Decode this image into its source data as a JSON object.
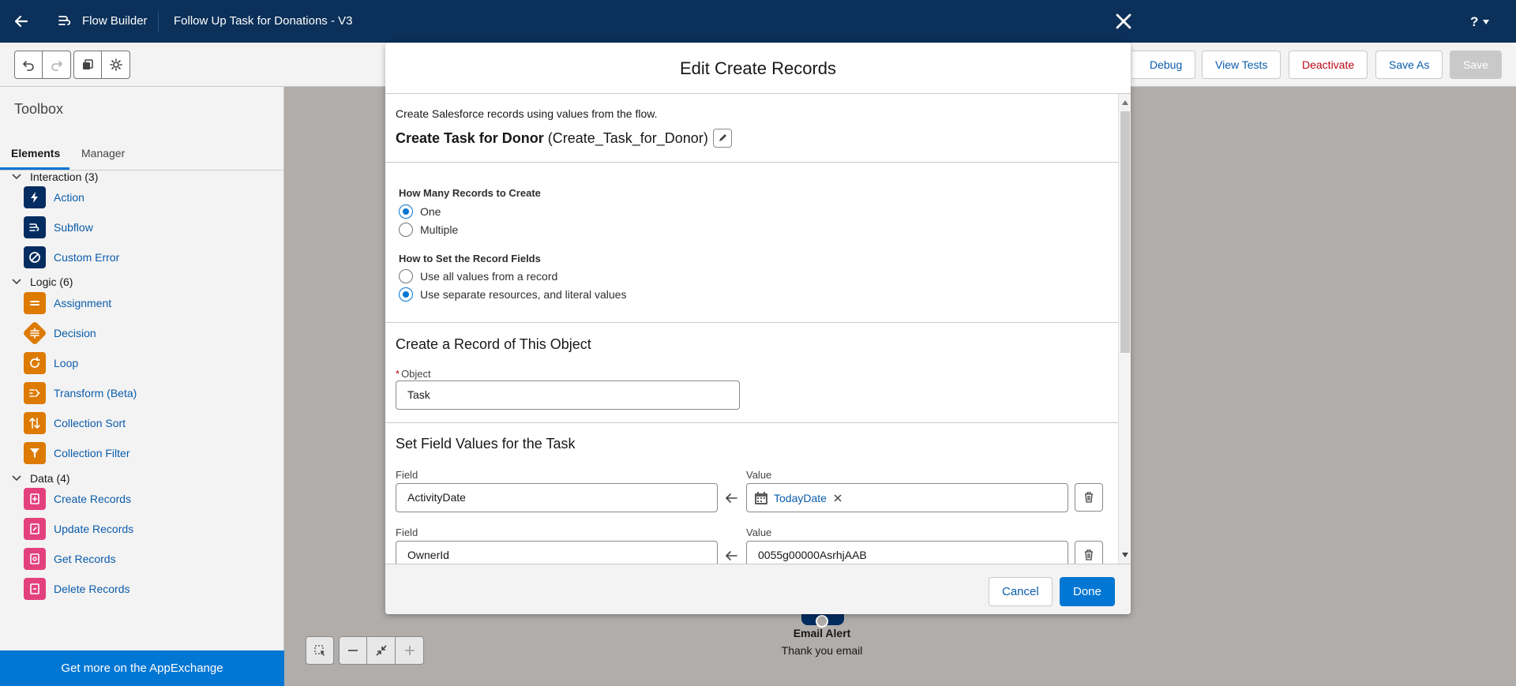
{
  "header": {
    "app_label": "Flow Builder",
    "flow_name": "Follow Up Task for Donations - V3",
    "help_label": "?"
  },
  "toolbar": {
    "debug_label": "Debug",
    "view_tests_label": "View Tests",
    "deactivate_label": "Deactivate",
    "save_as_label": "Save As",
    "save_label": "Save"
  },
  "toolbox": {
    "title": "Toolbox",
    "tabs": [
      "Elements",
      "Manager"
    ],
    "sections": [
      {
        "label": "Interaction (3)",
        "items": [
          "Action",
          "Subflow",
          "Custom Error"
        ]
      },
      {
        "label": "Logic (6)",
        "items": [
          "Assignment",
          "Decision",
          "Loop",
          "Transform (Beta)",
          "Collection Sort",
          "Collection Filter"
        ]
      },
      {
        "label": "Data (4)",
        "items": [
          "Create Records",
          "Update Records",
          "Get Records",
          "Delete Records"
        ]
      }
    ],
    "appexchange_label": "Get more on the AppExchange"
  },
  "canvas": {
    "node_title": "Email Alert",
    "node_subtitle": "Thank you email"
  },
  "modal": {
    "title": "Edit Create Records",
    "description": "Create Salesforce records using values from the flow.",
    "element_label": "Create Task for Donor",
    "element_api_name": "(Create_Task_for_Donor)",
    "how_many": {
      "label": "How Many Records to Create",
      "options": [
        "One",
        "Multiple"
      ],
      "selected": "One"
    },
    "how_set": {
      "label": "How to Set the Record Fields",
      "options": [
        "Use all values from a record",
        "Use separate resources, and literal values"
      ],
      "selected": "Use separate resources, and literal values"
    },
    "object_section": {
      "title": "Create a Record of This Object",
      "required_mark": "*",
      "object_label": "Object",
      "object_value": "Task"
    },
    "field_section": {
      "title": "Set Field Values for the Task",
      "rows": [
        {
          "field_label": "Field",
          "field_value": "ActivityDate",
          "value_label": "Value",
          "value": "TodayDate"
        },
        {
          "field_label": "Field",
          "field_value": "OwnerId",
          "value_label": "Value",
          "value": "0055g00000AsrhjAAB"
        }
      ]
    },
    "cancel_label": "Cancel",
    "done_label": "Done"
  }
}
